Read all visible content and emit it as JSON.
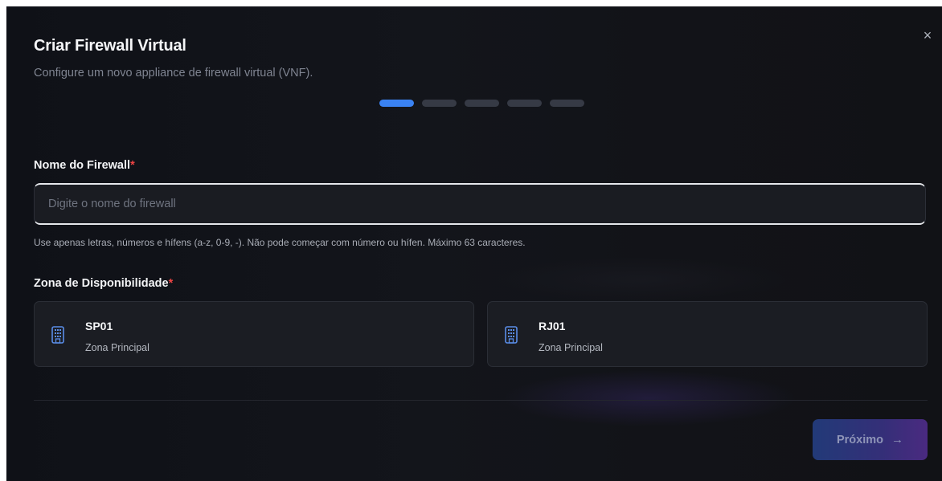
{
  "dialog": {
    "title": "Criar Firewall Virtual",
    "subtitle": "Configure um novo appliance de firewall virtual (VNF).",
    "close_label": "×",
    "steps": {
      "total": 5,
      "current": 1
    }
  },
  "name_field": {
    "label": "Nome do Firewall",
    "required_mark": "*",
    "placeholder": "Digite o nome do firewall",
    "value": "",
    "hint": "Use apenas letras, números e hífens (a-z, 0-9, -). Não pode começar com número ou hífen. Máximo 63 caracteres."
  },
  "zone_field": {
    "label": "Zona de Disponibilidade",
    "required_mark": "*",
    "options": [
      {
        "name": "SP01",
        "description": "Zona Principal",
        "icon": "building-icon"
      },
      {
        "name": "RJ01",
        "description": "Zona Principal",
        "icon": "building-icon"
      }
    ]
  },
  "footer": {
    "next_label": "Próximo",
    "next_icon": "→"
  },
  "colors": {
    "accent": "#3a82f2",
    "required": "#ef4444",
    "icon": "#5a8de8"
  }
}
